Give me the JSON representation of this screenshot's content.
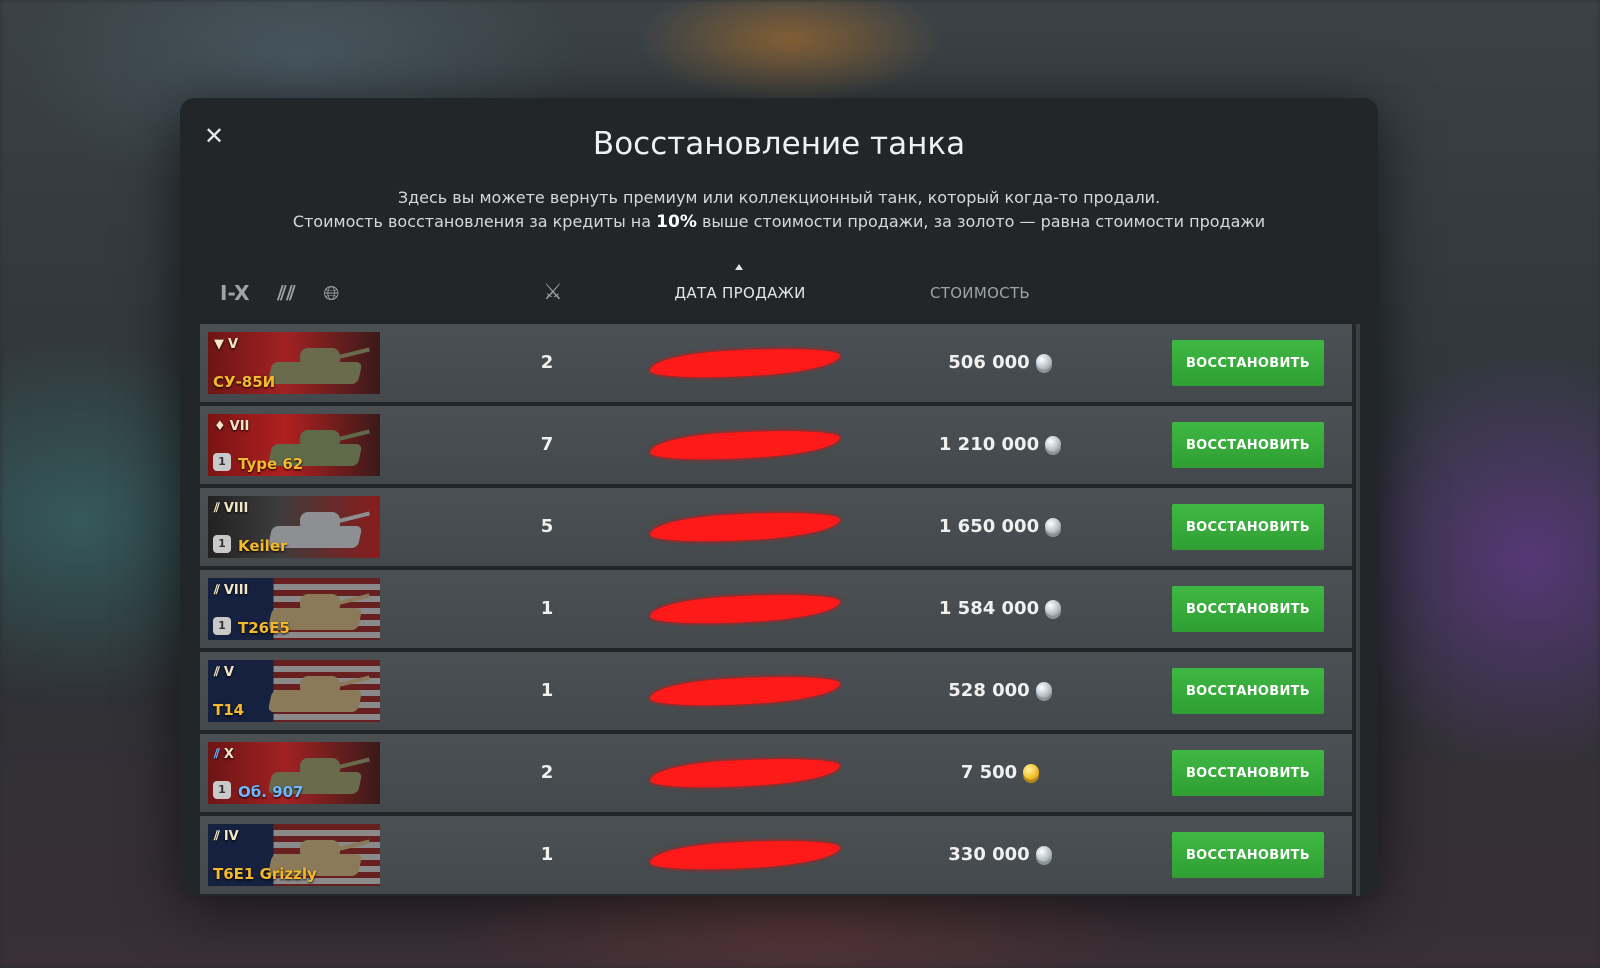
{
  "dialog": {
    "title": "Восстановление танка",
    "description_line1": "Здесь вы можете вернуть премиум или коллекционный танк, который когда-то продали.",
    "description_line2_prefix": "Стоимость восстановления за кредиты на ",
    "description_line2_bold": "10%",
    "description_line2_suffix": " выше стоимости продажи, за золото — равна стоимости продажи",
    "close_icon": "close-icon"
  },
  "filters": {
    "tier_label": "I-X",
    "type_icon": "vehicle-type-icon",
    "nation_icon": "globe-icon",
    "battles_icon": "crossed-swords-icon"
  },
  "columns": {
    "sale_date": "ДАТА ПРОДАЖИ",
    "cost": "СТОИМОСТЬ"
  },
  "colors": {
    "accent_green": "#3fb843",
    "premium_name": "#f5b92d",
    "collector_name": "#6fb7ff",
    "redaction": "#ff1a1a"
  },
  "tanks": [
    {
      "tier": "V",
      "marker": "▼",
      "name": "СУ-85И",
      "flag": "ussr",
      "badge": "",
      "count": "2",
      "cost": "506 000",
      "currency": "silver",
      "action": "ВОССТАНОВИТЬ"
    },
    {
      "tier": "VII",
      "marker": "♦",
      "name": "Type 62",
      "flag": "china",
      "badge": "1",
      "count": "7",
      "cost": "1 210 000",
      "currency": "silver",
      "action": "ВОССТАНОВИТЬ"
    },
    {
      "tier": "VIII",
      "marker": "⫽",
      "name": "Keiler",
      "flag": "germany",
      "badge": "1",
      "count": "5",
      "cost": "1 650 000",
      "currency": "silver",
      "action": "ВОССТАНОВИТЬ"
    },
    {
      "tier": "VIII",
      "marker": "⫽",
      "name": "T26E5",
      "flag": "usa",
      "badge": "1",
      "count": "1",
      "cost": "1 584 000",
      "currency": "silver",
      "action": "ВОССТАНОВИТЬ"
    },
    {
      "tier": "V",
      "marker": "⫽",
      "name": "T14",
      "flag": "usa",
      "badge": "",
      "count": "1",
      "cost": "528 000",
      "currency": "silver",
      "action": "ВОССТАНОВИТЬ"
    },
    {
      "tier": "X",
      "marker": "⫽",
      "name": "Об. 907",
      "flag": "ussr",
      "badge": "1",
      "count": "2",
      "cost": "7 500",
      "currency": "gold",
      "action": "ВОССТАНОВИТЬ"
    },
    {
      "tier": "IV",
      "marker": "⫽",
      "name": "T6E1 Grizzly",
      "flag": "usa",
      "badge": "",
      "count": "1",
      "cost": "330 000",
      "currency": "silver",
      "action": "ВОССТАНОВИТЬ"
    }
  ]
}
